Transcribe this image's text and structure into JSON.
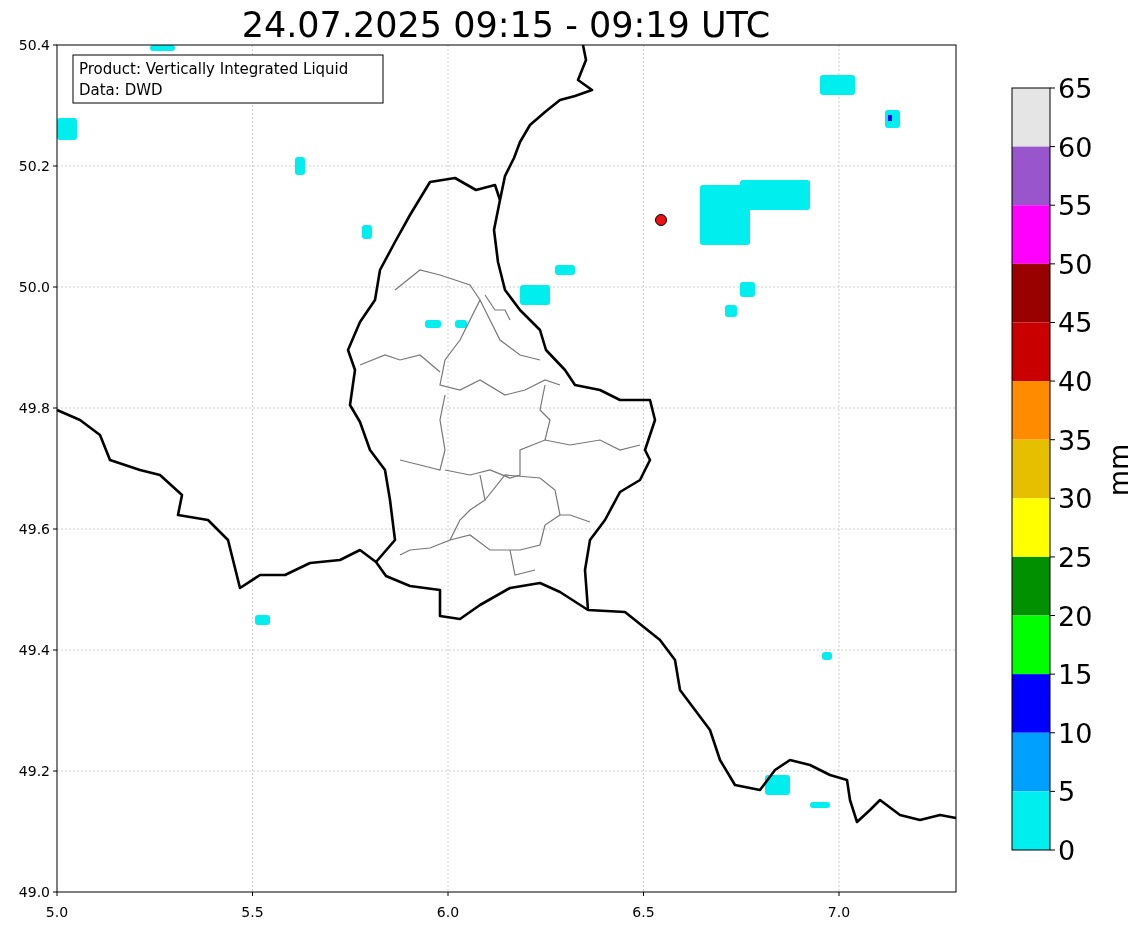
{
  "title": "24.07.2025 09:15 - 09:19 UTC",
  "info_box": {
    "lines": [
      "Product: Vertically Integrated Liquid",
      "Data: DWD"
    ]
  },
  "map": {
    "xticks": [
      "5.0",
      "5.5",
      "6.0",
      "6.5",
      "7.0"
    ],
    "yticks": [
      "50.4",
      "50.2",
      "50.0",
      "49.8",
      "49.6",
      "49.4",
      "49.2",
      "49.0"
    ]
  },
  "colorbar": {
    "label": "mm",
    "ticks": [
      "65",
      "60",
      "55",
      "50",
      "45",
      "40",
      "35",
      "30",
      "25",
      "20",
      "15",
      "10",
      "5",
      "0"
    ],
    "segments": [
      {
        "color": "#e5e5e5"
      },
      {
        "color": "#9955cc"
      },
      {
        "color": "#ff00ff"
      },
      {
        "color": "#990000"
      },
      {
        "color": "#c80000"
      },
      {
        "color": "#ff8c00"
      },
      {
        "color": "#e6c000"
      },
      {
        "color": "#ffff00"
      },
      {
        "color": "#009000"
      },
      {
        "color": "#00ff00"
      },
      {
        "color": "#0000ff"
      },
      {
        "color": "#00a0ff"
      },
      {
        "color": "#00eeee"
      }
    ]
  }
}
